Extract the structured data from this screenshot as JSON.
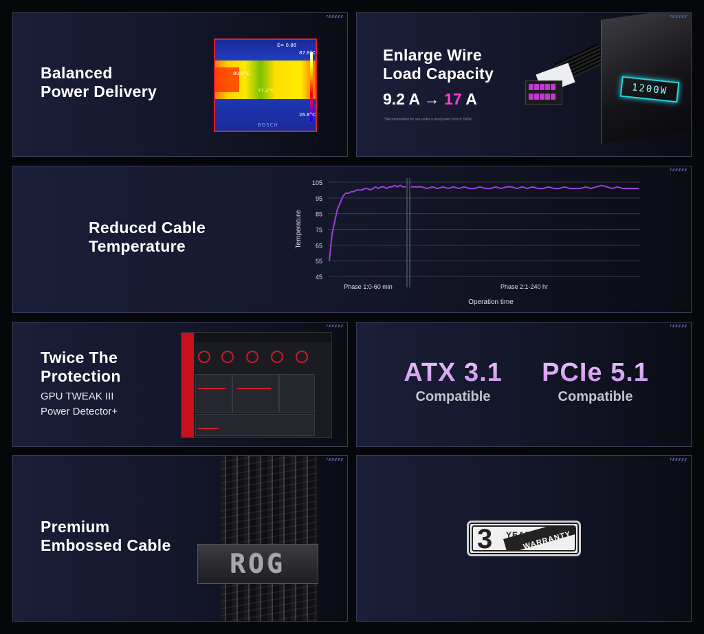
{
  "cards": {
    "power": {
      "title_line1": "Balanced",
      "title_line2": "Power Delivery",
      "thermal": {
        "emissivity": "E= 0.88",
        "max_temp": "87.8°C",
        "spot1": "80.0°C",
        "spot2": "77.2°C",
        "min_temp": "26.8°C",
        "brand": "BOSCH"
      }
    },
    "wire": {
      "title_line1": "Enlarge Wire",
      "title_line2": "Load Capacity",
      "amps_from": "9.2 A →",
      "amps_to": "17",
      "amps_unit": "A",
      "note": "*Recommended for use under a total power limit of 600W",
      "psu_label": "1200W"
    },
    "temperature": {
      "title_line1": "Reduced Cable",
      "title_line2": "Temperature"
    },
    "protection": {
      "title_line1": "Twice The",
      "title_line2": "Protection",
      "sub_line1": "GPU TWEAK III",
      "sub_line2": "Power Detector+"
    },
    "compat": {
      "atx_big": "ATX 3.1",
      "atx_small": "Compatible",
      "pcie_big": "PCIe 5.1",
      "pcie_small": "Compatible"
    },
    "cable": {
      "title_line1": "Premium",
      "title_line2": "Embossed Cable",
      "clip_text": "ROG"
    },
    "warranty": {
      "number": "3",
      "year": "YEAR",
      "word": "WARRANTY"
    }
  },
  "chart_data": {
    "type": "line",
    "title": "",
    "xlabel": "Operation time",
    "ylabel": "Temperature",
    "ylim": [
      45,
      105
    ],
    "yticks": [
      105,
      95,
      85,
      75,
      65,
      55,
      45
    ],
    "phases": [
      "Phase 1:0-60 min",
      "Phase 2:1-240 hr"
    ],
    "color": "#a040e0",
    "phase1_y": [
      55,
      72,
      80,
      88,
      92,
      96,
      98,
      98,
      99,
      99,
      100,
      100,
      100,
      101,
      101,
      100,
      101,
      102,
      101,
      102,
      102,
      101,
      102,
      102,
      103,
      102,
      103,
      102,
      102
    ],
    "phase2_y": [
      102,
      102,
      102,
      101,
      102,
      101,
      102,
      101,
      102,
      101,
      102,
      101,
      101,
      102,
      101,
      101,
      102,
      101,
      102,
      102,
      101,
      102,
      101,
      102,
      101,
      101,
      102,
      101,
      101,
      102,
      101,
      101,
      101,
      102,
      101,
      102,
      103,
      102,
      101,
      102,
      101,
      101,
      101,
      101
    ]
  }
}
